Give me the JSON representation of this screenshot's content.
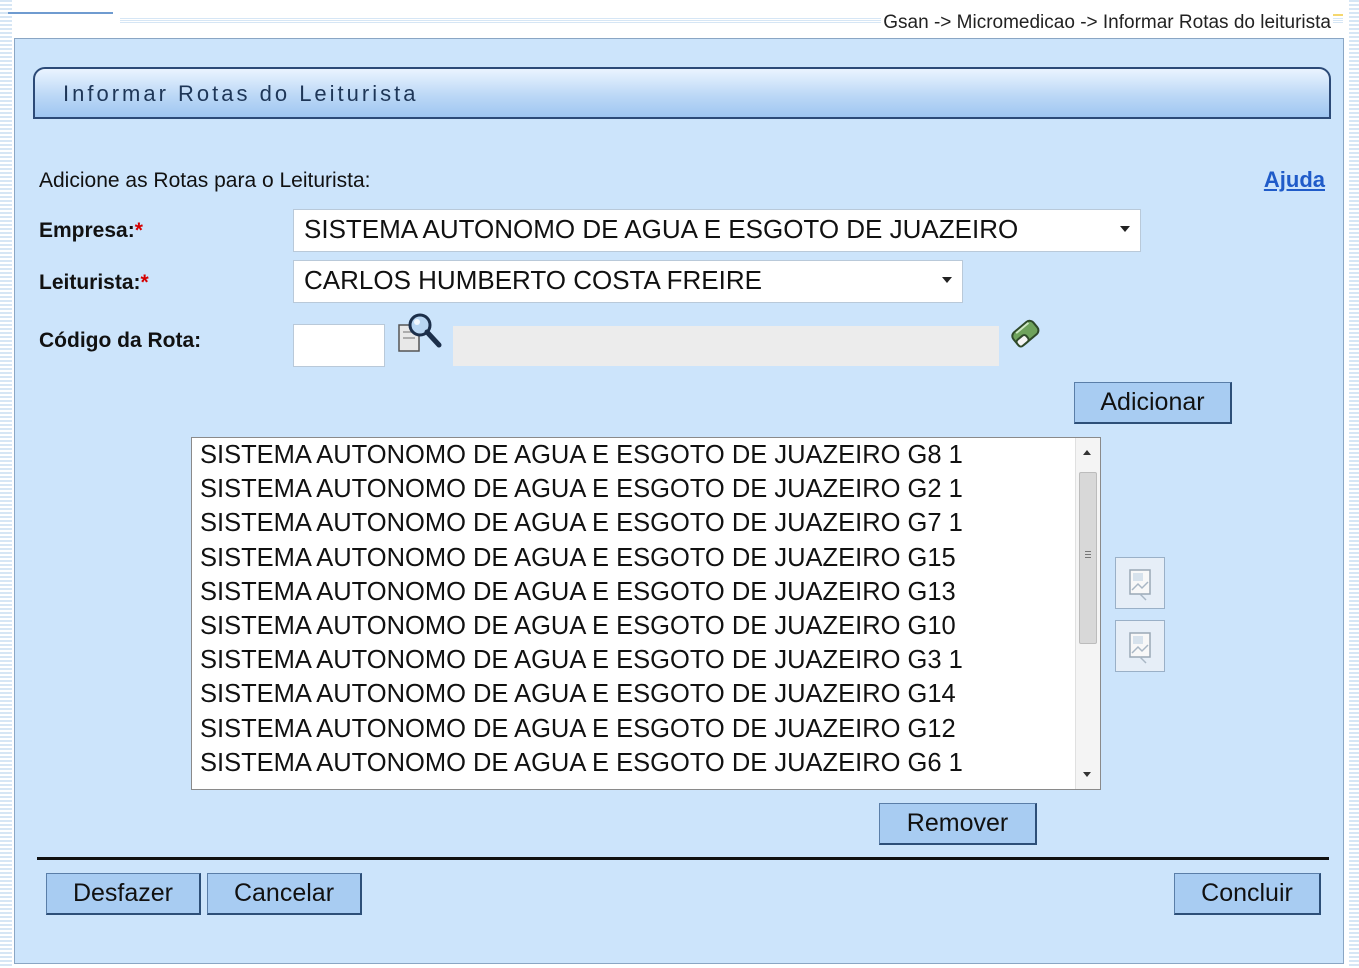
{
  "breadcrumb": "Gsan -> Micromedicao -> Informar Rotas do leiturista",
  "title": "Informar Rotas do Leiturista",
  "intro": "Adicione as Rotas para o Leiturista:",
  "help_link": "Ajuda",
  "required_marker": "*",
  "empresa": {
    "label": "Empresa:",
    "value": "SISTEMA AUTONOMO DE AGUA E ESGOTO DE JUAZEIRO"
  },
  "leiturista": {
    "label": "Leiturista:",
    "value": "CARLOS HUMBERTO COSTA FREIRE"
  },
  "codigo_rota": {
    "label": "Código da Rota:",
    "value": "",
    "description": ""
  },
  "buttons": {
    "adicionar": "Adicionar",
    "remover": "Remover",
    "desfazer": "Desfazer",
    "cancelar": "Cancelar",
    "concluir": "Concluir"
  },
  "rotas_list": [
    "SISTEMA AUTONOMO DE AGUA E ESGOTO DE JUAZEIRO G8 1",
    "SISTEMA AUTONOMO DE AGUA E ESGOTO DE JUAZEIRO G2 1",
    "SISTEMA AUTONOMO DE AGUA E ESGOTO DE JUAZEIRO G7 1",
    "SISTEMA AUTONOMO DE AGUA E ESGOTO DE JUAZEIRO G15",
    "SISTEMA AUTONOMO DE AGUA E ESGOTO DE JUAZEIRO G13",
    "SISTEMA AUTONOMO DE AGUA E ESGOTO DE JUAZEIRO G10",
    "SISTEMA AUTONOMO DE AGUA E ESGOTO DE JUAZEIRO G3 1",
    "SISTEMA AUTONOMO DE AGUA E ESGOTO DE JUAZEIRO G14",
    "SISTEMA AUTONOMO DE AGUA E ESGOTO DE JUAZEIRO G12",
    "SISTEMA AUTONOMO DE AGUA E ESGOTO DE JUAZEIRO G6 1"
  ],
  "icons": {
    "search": "magnifier-search-icon",
    "clear": "eraser-icon",
    "move_up": "move-up-icon",
    "move_down": "move-down-icon"
  },
  "colors": {
    "panel_bg": "#cce4fb",
    "button_bg": "#a8ccf2",
    "link": "#1f5bc9",
    "required": "#d40000"
  }
}
